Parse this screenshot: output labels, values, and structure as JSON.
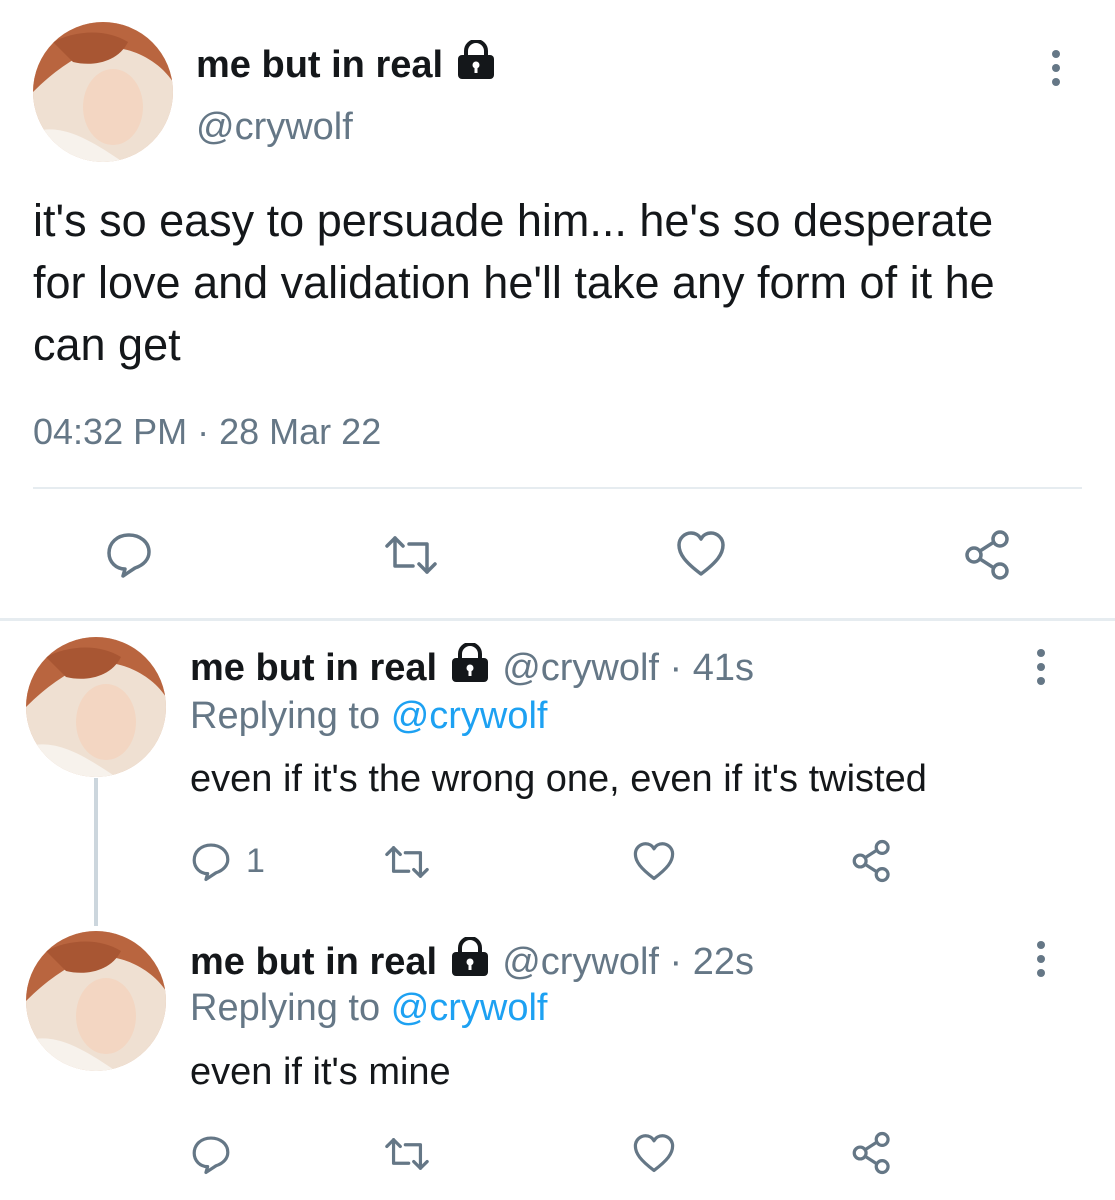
{
  "main_tweet": {
    "display_name": "me but in real",
    "handle": "@crywolf",
    "text": "it's so easy to persuade him... he's so desperate for love and validation he'll take any form of it he can get",
    "time": "04:32 PM",
    "date_sep": "·",
    "date": "28 Mar 22"
  },
  "replies": [
    {
      "display_name": "me but in real",
      "meta": "@crywolf · 41s",
      "replying_prefix": "Replying to",
      "replying_handle": "@crywolf",
      "text": "even if it's the wrong one, even if it's twisted",
      "reply_count": "1"
    },
    {
      "display_name": "me but in real",
      "meta": "@crywolf · 22s",
      "replying_prefix": "Replying to",
      "replying_handle": "@crywolf",
      "text": "even if it's mine",
      "reply_count": ""
    }
  ],
  "icons": {
    "reply": "reply-icon",
    "retweet": "retweet-icon",
    "like": "heart-icon",
    "share": "share-icon",
    "lock": "lock-icon",
    "more": "more-options-icon"
  },
  "colors": {
    "text": "#14171a",
    "muted": "#657786",
    "link": "#1da1f2",
    "divider": "#e6ecf0"
  }
}
